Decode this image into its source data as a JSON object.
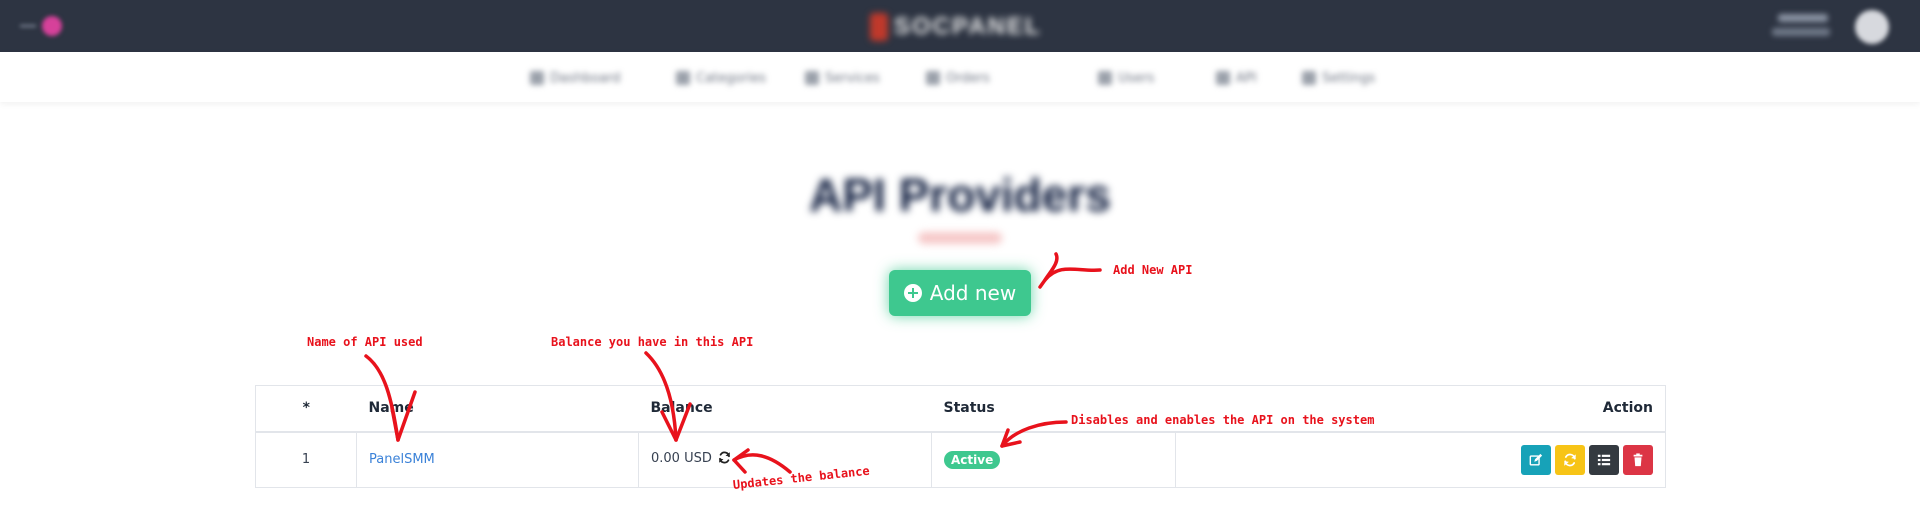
{
  "header": {
    "logo_text": "SOCPANEL",
    "user_name": "Admin"
  },
  "subnav": {
    "items": [
      {
        "label": "Dashboard",
        "icon": "dashboard-icon"
      },
      {
        "label": "Categories",
        "icon": "list-icon"
      },
      {
        "label": "Services",
        "icon": "box-icon"
      },
      {
        "label": "Orders",
        "icon": "cart-icon"
      },
      {
        "label": "Users",
        "icon": "users-icon"
      },
      {
        "label": "API",
        "icon": "code-icon"
      },
      {
        "label": "Settings",
        "icon": "gear-icon"
      }
    ]
  },
  "page": {
    "subtitle": "",
    "title": "API Providers"
  },
  "add_button": {
    "label": "Add new",
    "icon": "plus-circle-icon"
  },
  "table": {
    "columns": {
      "index": "*",
      "name": "Name",
      "balance": "Balance",
      "status": "Status",
      "action": "Action"
    },
    "rows": [
      {
        "index": "1",
        "name": "PanelSMM",
        "balance": "0.00 USD",
        "status": "Active"
      }
    ]
  },
  "annotations": {
    "add_new": "Add New API",
    "name": "Name of API used",
    "balance": "Balance you have in this API",
    "status": "Disables and enables the API on the system",
    "refresh": "Updates the balance"
  },
  "colors": {
    "topbar": "#2d3442",
    "accent_green": "#3ec88f",
    "link_blue": "#3b82d8",
    "annotation_red": "#e8121c",
    "edit_cyan": "#17a2b8",
    "sync_yellow": "#f7c416",
    "list_dark": "#343a40",
    "delete_red": "#dc3545"
  }
}
